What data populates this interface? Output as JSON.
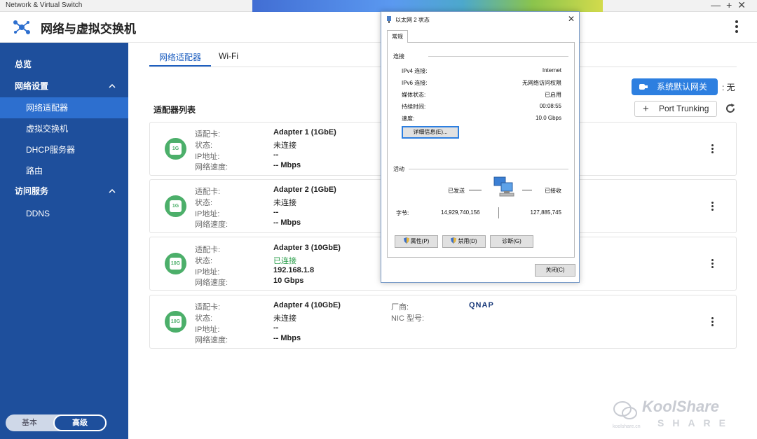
{
  "window": {
    "title": "Network & Virtual Switch",
    "controls": [
      "—",
      "+",
      "✕"
    ]
  },
  "app": {
    "title": "网络与虚拟交换机"
  },
  "sidebar": {
    "items": [
      {
        "label": "总览"
      },
      {
        "label": "网络设置"
      },
      {
        "label": "网络适配器"
      },
      {
        "label": "虚拟交换机"
      },
      {
        "label": "DHCP服务器"
      },
      {
        "label": "路由"
      },
      {
        "label": "访问服务"
      },
      {
        "label": "DDNS"
      }
    ],
    "mode_basic": "基本",
    "mode_advanced": "高级"
  },
  "tabs": [
    {
      "label": "网络适配器"
    },
    {
      "label": "Wi-Fi"
    }
  ],
  "toolbar": {
    "gateway_label": "系统默认网关",
    "gateway_value": ": 无",
    "section_title": "适配器列表",
    "port_trunking": "Port Trunking"
  },
  "labels": {
    "adapter": "适配卡:",
    "status": "状态:",
    "ip": "IP地址:",
    "speed": "网络速度:",
    "vendor": "厂商:",
    "nic_model": "NIC 型号:"
  },
  "adapters": [
    {
      "badge": "1G",
      "name": "Adapter 1 (1GbE)",
      "status": "未连接",
      "ip": "--",
      "speed": "-- Mbps"
    },
    {
      "badge": "1G",
      "name": "Adapter 2 (1GbE)",
      "status": "未连接",
      "ip": "--",
      "speed": "-- Mbps"
    },
    {
      "badge": "10G",
      "name": "Adapter 3 (10GbE)",
      "status": "已连接",
      "ip": "192.168.1.8",
      "speed": "10 Gbps"
    },
    {
      "badge": "10G",
      "name": "Adapter 4 (10GbE)",
      "status": "未连接",
      "ip": "--",
      "speed": "-- Mbps",
      "vendor": "QNAP"
    }
  ],
  "dialog": {
    "title": "以太网 2 状态",
    "tab": "常规",
    "connection_group": "连接",
    "rows": [
      {
        "key": "IPv4 连接:",
        "value": "Internet"
      },
      {
        "key": "IPv6 连接:",
        "value": "无网络访问权限"
      },
      {
        "key": "媒体状态:",
        "value": "已启用"
      },
      {
        "key": "持续时间:",
        "value": "00:08:55"
      },
      {
        "key": "速度:",
        "value": "10.0 Gbps"
      }
    ],
    "details_button": "详细信息(E)...",
    "activity_group": "活动",
    "sent_label": "已发送",
    "received_label": "已接收",
    "bytes_label": "字节:",
    "bytes_sent": "14,929,740,156",
    "bytes_received": "127,885,745",
    "properties_button": "属性(P)",
    "disable_button": "禁用(D)",
    "diagnose_button": "诊断(G)",
    "close_button": "关闭(C)"
  },
  "watermark": {
    "brand": "KoolShare",
    "sub": "SHARE",
    "tag": "koolshare.cn"
  },
  "colors": {
    "sidebar": "#1e4f9c",
    "sidebar_active": "#2d6fcf",
    "accent": "#2d7fe0",
    "connected": "#2a9d4a",
    "badge": "#4caf6a"
  }
}
